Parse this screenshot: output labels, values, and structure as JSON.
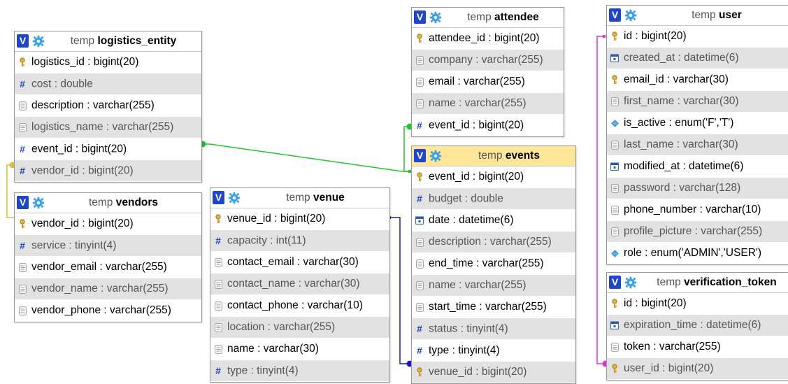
{
  "tables": {
    "logistics_entity": {
      "prefix": "temp",
      "name": "logistics_entity",
      "columns": [
        {
          "label": "logistics_id : bigint(20)",
          "icon": "key-icon"
        },
        {
          "label": "cost : double",
          "icon": "numeric-icon"
        },
        {
          "label": "description : varchar(255)",
          "icon": "text-icon"
        },
        {
          "label": "logistics_name : varchar(255)",
          "icon": "text-icon"
        },
        {
          "label": "event_id : bigint(20)",
          "icon": "numeric-icon"
        },
        {
          "label": "vendor_id : bigint(20)",
          "icon": "numeric-icon"
        }
      ]
    },
    "vendors": {
      "prefix": "temp",
      "name": "vendors",
      "columns": [
        {
          "label": "vendor_id : bigint(20)",
          "icon": "key-icon"
        },
        {
          "label": "service : tinyint(4)",
          "icon": "numeric-icon"
        },
        {
          "label": "vendor_email : varchar(255)",
          "icon": "text-icon"
        },
        {
          "label": "vendor_name : varchar(255)",
          "icon": "text-icon"
        },
        {
          "label": "vendor_phone : varchar(255)",
          "icon": "text-icon"
        }
      ]
    },
    "venue": {
      "prefix": "temp",
      "name": "venue",
      "columns": [
        {
          "label": "venue_id : bigint(20)",
          "icon": "key-icon"
        },
        {
          "label": "capacity : int(11)",
          "icon": "numeric-icon"
        },
        {
          "label": "contact_email : varchar(30)",
          "icon": "text-icon"
        },
        {
          "label": "contact_name : varchar(30)",
          "icon": "text-icon"
        },
        {
          "label": "contact_phone : varchar(10)",
          "icon": "text-icon"
        },
        {
          "label": "location : varchar(255)",
          "icon": "text-icon"
        },
        {
          "label": "name : varchar(30)",
          "icon": "text-icon"
        },
        {
          "label": "type : tinyint(4)",
          "icon": "numeric-icon"
        }
      ]
    },
    "attendee": {
      "prefix": "temp",
      "name": "attendee",
      "columns": [
        {
          "label": "attendee_id : bigint(20)",
          "icon": "key-icon"
        },
        {
          "label": "company : varchar(255)",
          "icon": "text-icon"
        },
        {
          "label": "email : varchar(255)",
          "icon": "text-icon"
        },
        {
          "label": "name : varchar(255)",
          "icon": "text-icon"
        },
        {
          "label": "event_id : bigint(20)",
          "icon": "numeric-icon"
        }
      ]
    },
    "events": {
      "prefix": "temp",
      "name": "events",
      "columns": [
        {
          "label": "event_id : bigint(20)",
          "icon": "key-icon"
        },
        {
          "label": "budget : double",
          "icon": "numeric-icon"
        },
        {
          "label": "date : datetime(6)",
          "icon": "datetime-icon"
        },
        {
          "label": "description : varchar(255)",
          "icon": "text-icon"
        },
        {
          "label": "end_time : varchar(255)",
          "icon": "text-icon"
        },
        {
          "label": "name : varchar(255)",
          "icon": "text-icon"
        },
        {
          "label": "start_time : varchar(255)",
          "icon": "text-icon"
        },
        {
          "label": "status : tinyint(4)",
          "icon": "numeric-icon"
        },
        {
          "label": "type : tinyint(4)",
          "icon": "numeric-icon"
        },
        {
          "label": "venue_id : bigint(20)",
          "icon": "key-icon"
        }
      ]
    },
    "user": {
      "prefix": "temp",
      "name": "user",
      "columns": [
        {
          "label": "id : bigint(20)",
          "icon": "key-icon"
        },
        {
          "label": "created_at : datetime(6)",
          "icon": "datetime-icon"
        },
        {
          "label": "email_id : varchar(30)",
          "icon": "key-icon"
        },
        {
          "label": "first_name : varchar(30)",
          "icon": "text-icon"
        },
        {
          "label": "is_active : enum('F','T')",
          "icon": "enum-icon"
        },
        {
          "label": "last_name : varchar(30)",
          "icon": "text-icon"
        },
        {
          "label": "modified_at : datetime(6)",
          "icon": "datetime-icon"
        },
        {
          "label": "password : varchar(128)",
          "icon": "text-icon"
        },
        {
          "label": "phone_number : varchar(10)",
          "icon": "text-icon"
        },
        {
          "label": "profile_picture : varchar(255)",
          "icon": "text-icon"
        },
        {
          "label": "role : enum('ADMIN','USER')",
          "icon": "enum-icon"
        }
      ]
    },
    "verification_token": {
      "prefix": "temp",
      "name": "verification_token",
      "columns": [
        {
          "label": "id : bigint(20)",
          "icon": "key-icon"
        },
        {
          "label": "expiration_time : datetime(6)",
          "icon": "datetime-icon"
        },
        {
          "label": "token : varchar(255)",
          "icon": "text-icon"
        },
        {
          "label": "user_id : bigint(20)",
          "icon": "key-icon"
        }
      ]
    }
  },
  "buttons": {
    "view_label": "V"
  },
  "colors": {
    "header_highlight": "#ffe79a",
    "row_alt": "#e2e2e2",
    "link_green": "#22c42b",
    "link_yellow": "#d8c23a",
    "link_blue": "#1a1ab0",
    "link_magenta": "#d63ad6"
  }
}
